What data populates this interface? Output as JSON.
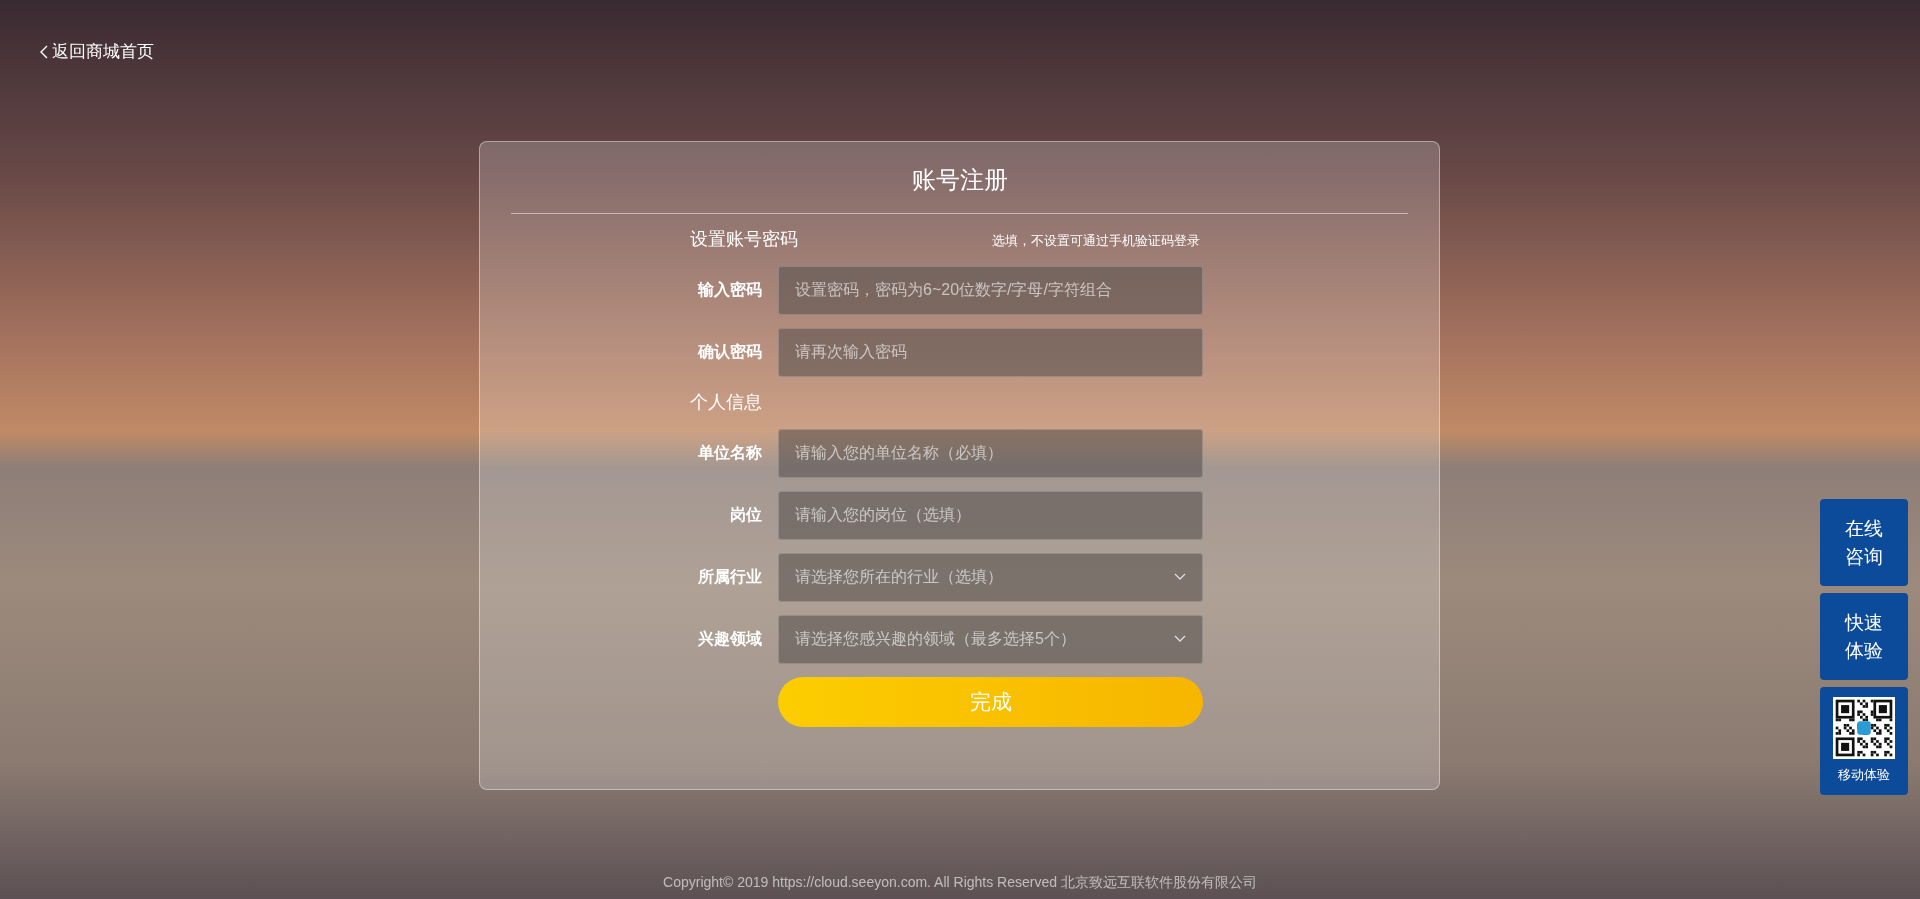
{
  "back_link": {
    "label": "返回商城首页"
  },
  "form": {
    "title": "账号注册",
    "sections": [
      {
        "heading": "设置账号密码",
        "note": "选填，不设置可通过手机验证码登录",
        "fields": [
          {
            "kind": "input",
            "label": "输入密码",
            "placeholder": "设置密码，密码为6~20位数字/字母/字符组合"
          },
          {
            "kind": "input",
            "label": "确认密码",
            "placeholder": "请再次输入密码"
          }
        ]
      },
      {
        "heading": "个人信息",
        "fields": [
          {
            "kind": "input",
            "label": "单位名称",
            "placeholder": "请输入您的单位名称（必填）"
          },
          {
            "kind": "input",
            "label": "岗位",
            "placeholder": "请输入您的岗位（选填）"
          },
          {
            "kind": "select",
            "label": "所属行业",
            "placeholder": "请选择您所在的行业（选填）"
          },
          {
            "kind": "select",
            "label": "兴趣领域",
            "placeholder": "请选择您感兴趣的领域（最多选择5个）"
          }
        ]
      }
    ],
    "submit": "完成"
  },
  "side_buttons": [
    {
      "kind": "text",
      "label": "在线咨询"
    },
    {
      "kind": "text",
      "label": "快速体验"
    },
    {
      "kind": "qr",
      "label": "移动体验"
    }
  ],
  "footer": "Copyright© 2019 https://cloud.seeyon.com. All Rights Reserved 北京致远互联软件股份有限公司"
}
